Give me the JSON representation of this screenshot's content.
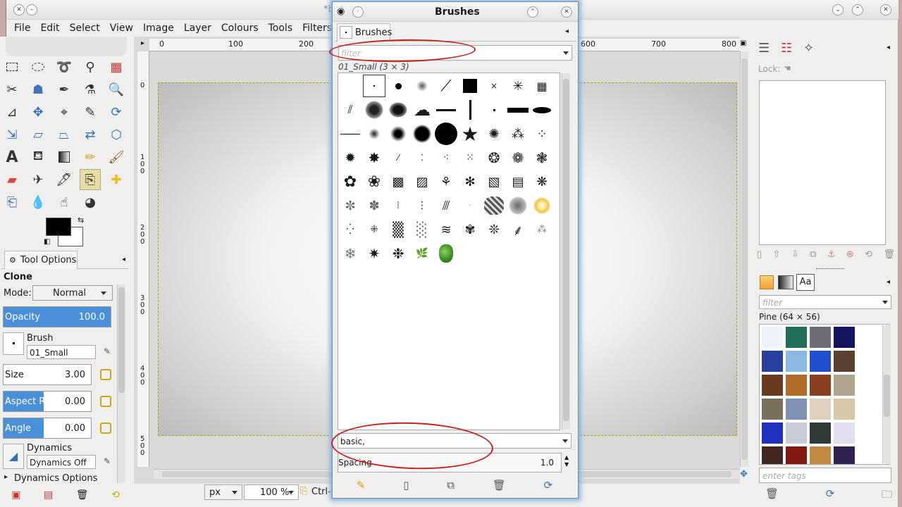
{
  "main_window": {
    "title_partial": "*b",
    "menu": [
      "File",
      "Edit",
      "Select",
      "View",
      "Image",
      "Layer",
      "Colours",
      "Tools",
      "Filters"
    ],
    "ruler_top_labels": [
      "0",
      "100",
      "200",
      "600",
      "700",
      "800"
    ],
    "ruler_left_labels": [
      "0",
      "1 0 0",
      "2 0 0",
      "3 0 0",
      "4 0 0",
      "5 0 0"
    ],
    "status": {
      "unit": "px",
      "zoom": "100 %",
      "hint": "Ctrl-"
    }
  },
  "tool_options": {
    "tab_label": "Tool Options",
    "tool_name": "Clone",
    "mode_label": "Mode:",
    "mode_value": "Normal",
    "opacity": {
      "label": "Opacity",
      "value": "100.0",
      "fraction": 1.0
    },
    "brush": {
      "label": "Brush",
      "value": "01_Small"
    },
    "size": {
      "label": "Size",
      "value": "3.00",
      "fraction": 0.0
    },
    "aspect_ratio": {
      "label": "Aspect Ra...",
      "value": "0.00",
      "fraction": 0.5
    },
    "angle": {
      "label": "Angle",
      "value": "0.00",
      "fraction": 0.5
    },
    "dynamics": {
      "label": "Dynamics",
      "value": "Dynamics Off"
    },
    "dynamics_options": "Dynamics Options"
  },
  "brushes_dialog": {
    "title": "Brushes",
    "tab_label": "Brushes",
    "filter_placeholder": "filter",
    "selected_brush": "01_Small (3 × 3)",
    "tags_value": "basic,",
    "spacing_label": "Spacing",
    "spacing_value": "1.0"
  },
  "right_dock": {
    "lock_label": "Lock:",
    "patterns_filter_placeholder": "filter",
    "selected_pattern": "Pine (64 × 56)",
    "tags_placeholder": "enter tags",
    "text_tab": "Aa"
  },
  "colors": {
    "accent": "#4a90d9",
    "annotation_red": "#c42424",
    "dialog_glow": "#7fb0e0"
  }
}
